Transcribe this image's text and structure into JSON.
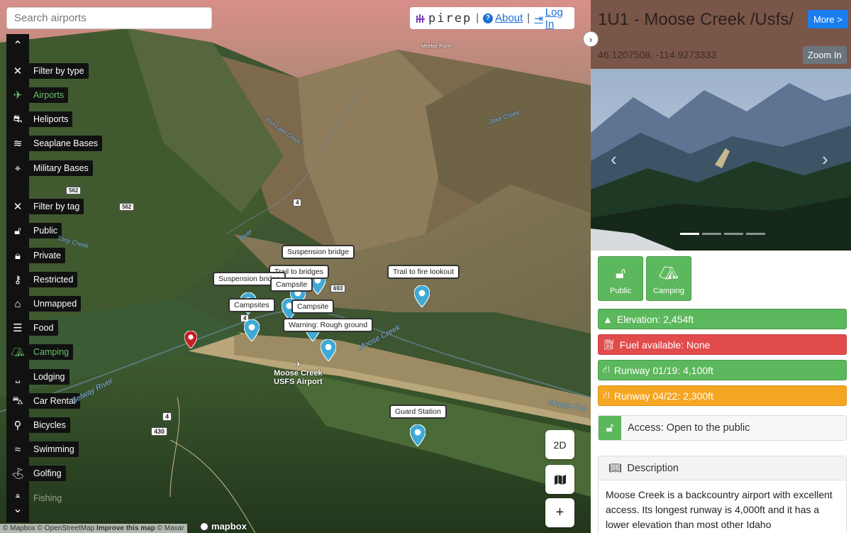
{
  "search": {
    "placeholder": "Search airports"
  },
  "brand": {
    "name": "pirep",
    "about": "About",
    "login": "Log In"
  },
  "sidebar": {
    "filters": [
      {
        "icon": "close-icon",
        "label": "Filter by type",
        "glyph": "✕",
        "active": false
      },
      {
        "icon": "airplane-icon",
        "label": "Airports",
        "glyph": "✈",
        "active": true
      },
      {
        "icon": "helicopter-icon",
        "label": "Heliports",
        "glyph": "⛐",
        "active": false
      },
      {
        "icon": "waves-icon",
        "label": "Seaplane Bases",
        "glyph": "≋",
        "active": false
      },
      {
        "icon": "crosshair-icon",
        "label": "Military Bases",
        "glyph": "⌖",
        "active": false
      },
      {
        "icon": "close-icon",
        "label": "Filter by tag",
        "glyph": "✕",
        "active": false
      },
      {
        "icon": "unlock-icon",
        "label": "Public",
        "glyph": "🔓︎",
        "active": false
      },
      {
        "icon": "lock-icon",
        "label": "Private",
        "glyph": "🔒︎",
        "active": false
      },
      {
        "icon": "key-icon",
        "label": "Restricted",
        "glyph": "⚷",
        "active": false
      },
      {
        "icon": "map-marker-icon",
        "label": "Unmapped",
        "glyph": "⌂",
        "active": false
      },
      {
        "icon": "burger-icon",
        "label": "Food",
        "glyph": "☰",
        "active": false
      },
      {
        "icon": "tent-icon",
        "label": "Camping",
        "glyph": "⛺︎",
        "active": true
      },
      {
        "icon": "bed-icon",
        "label": "Lodging",
        "glyph": "⎵",
        "active": false
      },
      {
        "icon": "car-icon",
        "label": "Car Rental",
        "glyph": "⛍",
        "active": false
      },
      {
        "icon": "bicycle-icon",
        "label": "Bicycles",
        "glyph": "⚲",
        "active": false
      },
      {
        "icon": "swimmer-icon",
        "label": "Swimming",
        "glyph": "≈",
        "active": false
      },
      {
        "icon": "golf-icon",
        "label": "Golfing",
        "glyph": "⛳︎",
        "active": false
      },
      {
        "icon": "fishing-icon",
        "label": "Fishing",
        "glyph": "⚓︎",
        "active": false
      }
    ]
  },
  "map": {
    "labels": [
      "Suspension bridge",
      "Trail to bridges",
      "Suspension bridge",
      "Campsite",
      "Campsites",
      "Campsite",
      "Warning: Rough ground",
      "Trail to fire lookout",
      "Guard Station"
    ],
    "airport_name": "Moose Creek\nUSFS Airport",
    "airport_line1": "Moose Creek",
    "airport_line2": "USFS Airport",
    "place_meeker": "Meeker Point",
    "rivers": [
      "Jake Creek",
      "Moose Creek",
      "Selway River",
      "Fish Lake Creek",
      "Moose Cre",
      "Tony Creek",
      "River"
    ],
    "roads": [
      "562",
      "562",
      "4",
      "693",
      "4",
      "4",
      "430"
    ],
    "buttons": {
      "view": "2D",
      "zoom_in": "+"
    },
    "attribution": {
      "mapbox": "© Mapbox",
      "osm": "© OpenStreetMap",
      "improve": "Improve this map",
      "maxar": "© Maxar",
      "logo": "mapbox"
    }
  },
  "panel": {
    "title": "1U1 - Moose Creek /Usfs/",
    "more": "More >",
    "coords": "46.1207508, -114.9273333",
    "zoom": "Zoom In",
    "tags": [
      {
        "icon": "unlock-icon",
        "label": "Public"
      },
      {
        "icon": "tent-icon",
        "label": "Camping"
      }
    ],
    "stats": [
      {
        "icon": "mountain-icon",
        "text": "Elevation: 2,454ft",
        "color": "green"
      },
      {
        "icon": "gas-pump-icon",
        "text": "Fuel available: None",
        "color": "red"
      },
      {
        "icon": "road-icon",
        "text": "Runway 01/19: 4,100ft",
        "color": "green"
      },
      {
        "icon": "road-icon",
        "text": "Runway 04/22: 2,300ft",
        "color": "orange"
      }
    ],
    "access": "Access: Open to the public",
    "description_title": "Description",
    "description": "Moose Creek is a backcountry airport with excellent access. Its longest runway is 4,000ft and it has a lower elevation than most other Idaho"
  },
  "colors": {
    "accent": "#1a7ef0",
    "header": "#7a5649",
    "green": "#5cb85c",
    "red": "#e24b4b",
    "orange": "#f5a623",
    "pin": "#3fa9d6",
    "pin_red": "#c81d25"
  }
}
